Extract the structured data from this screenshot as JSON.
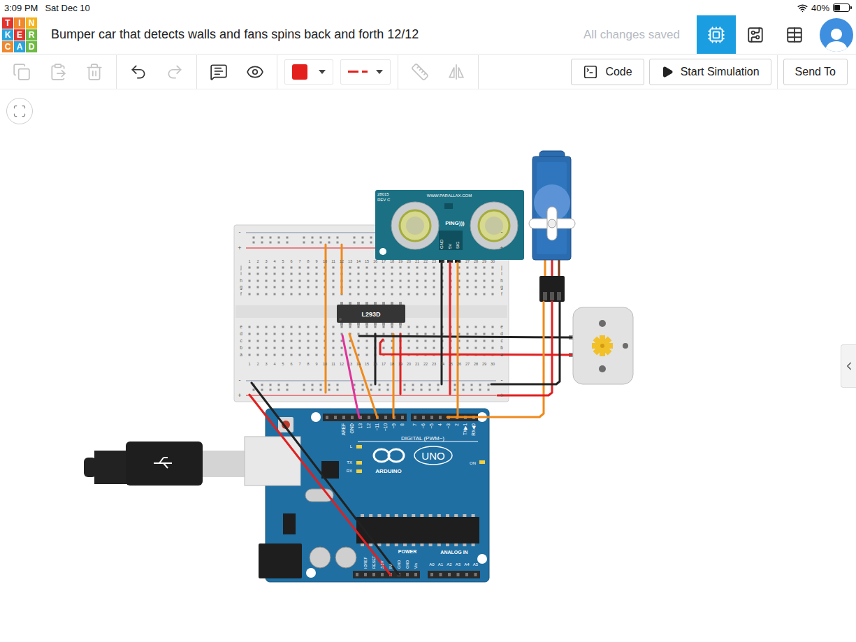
{
  "status_bar": {
    "time": "3:09 PM",
    "date": "Sat Dec 10",
    "battery": "40%",
    "battery_level": 0.4
  },
  "logo": {
    "letters": [
      "T",
      "I",
      "N",
      "K",
      "E",
      "R",
      "C",
      "A",
      "D"
    ]
  },
  "header": {
    "title": "Bumper car that detects walls and fans spins back and forth 12/12",
    "save_status": "All changes saved"
  },
  "views": [
    {
      "selected": true
    },
    {
      "selected": false
    },
    {
      "selected": false
    }
  ],
  "toolbar": {
    "groups": [
      [
        {
          "kind": "copy",
          "disabled": true
        },
        {
          "kind": "paste",
          "disabled": true
        },
        {
          "kind": "delete",
          "disabled": true
        }
      ],
      [
        {
          "kind": "undo",
          "disabled": false
        },
        {
          "kind": "redo",
          "disabled": true
        }
      ],
      [
        {
          "kind": "note",
          "disabled": false
        },
        {
          "kind": "visibility",
          "disabled": false
        }
      ],
      [
        {
          "kind": "color",
          "disabled": false,
          "color": "#e3201b"
        },
        {
          "kind": "line-style",
          "disabled": false,
          "color": "#e3201b"
        }
      ],
      [
        {
          "kind": "align",
          "disabled": true
        },
        {
          "kind": "mirror",
          "disabled": true
        }
      ]
    ],
    "actions": [
      {
        "kind": "code",
        "label": "Code"
      },
      {
        "kind": "simulate",
        "label": "Start Simulation"
      },
      {
        "kind": "send",
        "label": "Send To"
      }
    ]
  },
  "circuit": {
    "breadboard": {
      "rows_top": [
        "j",
        "i",
        "h",
        "g",
        "f"
      ],
      "rows_bottom": [
        "e",
        "d",
        "c",
        "b",
        "a"
      ],
      "columns": [
        "1",
        "2",
        "3",
        "4",
        "5",
        "6",
        "7",
        "8",
        "9",
        "10",
        "11",
        "12",
        "13",
        "14",
        "15",
        "16",
        "17",
        "18",
        "19",
        "20",
        "21",
        "22",
        "23",
        "24",
        "25",
        "26",
        "27",
        "28",
        "29",
        "30"
      ],
      "rail_minus": "-",
      "rail_plus": "+"
    },
    "chip": {
      "label": "L293D"
    },
    "sensor": {
      "model": "28015",
      "rev": "REV C",
      "url": "WWW.PARALLAX.COM",
      "name": "PING)))",
      "pins": [
        "GND",
        "5V",
        "SIG"
      ]
    },
    "arduino": {
      "digital_pins": [
        "AREF",
        "GND",
        "13",
        "12",
        "~11",
        "~10",
        "~9",
        "8",
        "7",
        "~6",
        "~5",
        "4",
        "~3",
        "2",
        "TX▶1",
        "RX◀0"
      ],
      "digital_label": "DIGITAL (PWM~)",
      "leds": [
        "L",
        "TX",
        "RX"
      ],
      "on_label": "ON",
      "brand": "ARDUINO",
      "model": "UNO",
      "power_label": "POWER",
      "power_pins": [
        "IOREF",
        "RESET",
        "3.3V",
        "5V",
        "GND",
        "GND",
        "Vin"
      ],
      "analog_label": "ANALOG IN",
      "analog_pins": [
        "A0",
        "A1",
        "A2",
        "A3",
        "A4",
        "A5"
      ]
    }
  }
}
